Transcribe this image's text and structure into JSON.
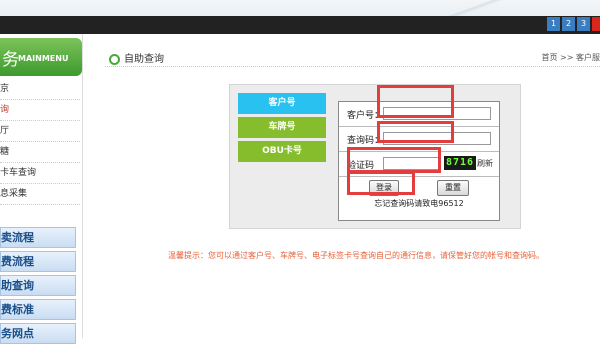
{
  "header": {
    "page_numbers": [
      "1",
      "2",
      "3",
      ""
    ]
  },
  "sidebar": {
    "menu_big": "务",
    "menu_title": "MAINMENU",
    "items": [
      "京",
      "询",
      "厅",
      "糖",
      "卡车查询",
      "息采集"
    ],
    "active_index": 1,
    "blue_items": [
      "卖流程",
      "费流程",
      "助查询",
      "费标准",
      "务网点"
    ]
  },
  "main": {
    "title": "自助查询",
    "breadcrumb": "首页 >> 客户服"
  },
  "tabs": [
    "客户号",
    "车牌号",
    "OBU卡号"
  ],
  "form": {
    "customer_label": "客户号：",
    "password_label": "查询码：",
    "captcha_label": "验证码",
    "captcha_value": "8716",
    "refresh": "刷新",
    "login": "登录",
    "reset": "重置",
    "forgot": "忘记查询码请致电96512"
  },
  "tip": "温馨提示：您可以通过客户号、车牌号、电子标签卡号查询自己的通行信息，请保管好您的帐号和查询码。",
  "colors": {
    "accent_green": "#4aa83a",
    "tab_blue": "#29c2f0",
    "tab_green": "#86bd2c",
    "highlight_red": "#e43d3d",
    "tip_orange": "#e8613a"
  }
}
